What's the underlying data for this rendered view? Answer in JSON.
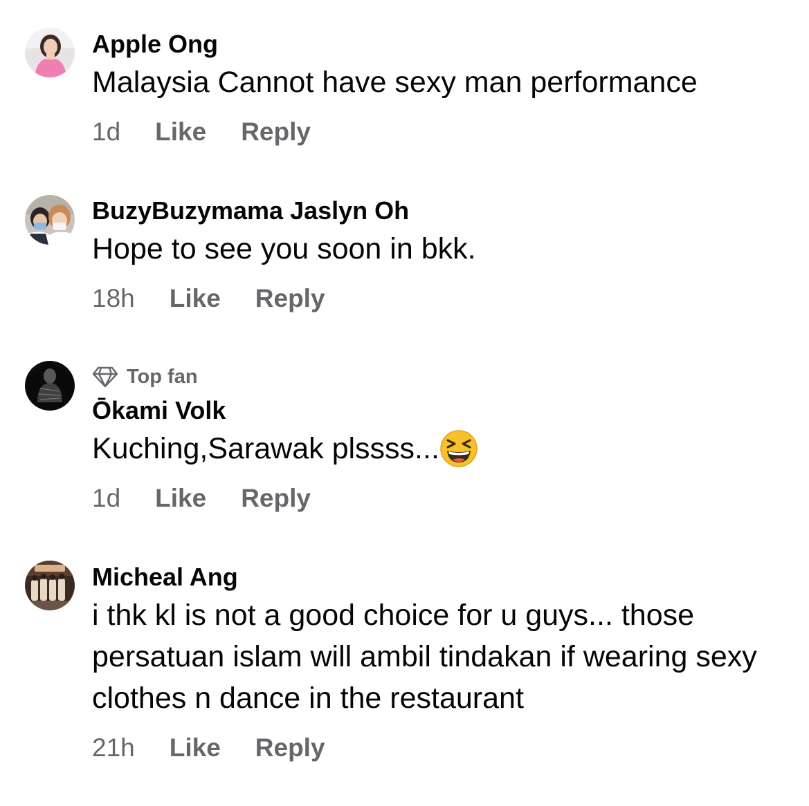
{
  "comments": [
    {
      "author": "Apple Ong",
      "text": "Malaysia Cannot have sexy man performance",
      "time": "1d",
      "like_label": "Like",
      "reply_label": "Reply",
      "avatar_icon": "profile-photo-woman-pink"
    },
    {
      "author": "BuzyBuzymama Jaslyn Oh",
      "text": "Hope to see you soon in bkk.",
      "time": "18h",
      "like_label": "Like",
      "reply_label": "Reply",
      "avatar_icon": "profile-photo-two-people-masks"
    },
    {
      "badge": "Top fan",
      "badge_icon": "diamond-icon",
      "author": "Ōkami Volk",
      "text": "Kuching,Sarawak plssss...",
      "emoji": "grinning-squinting-face-emoji",
      "time": "1d",
      "like_label": "Like",
      "reply_label": "Reply",
      "avatar_icon": "profile-photo-dark-figure"
    },
    {
      "author": "Micheal Ang",
      "text": "i thk kl is not a good choice for u guys... those persatuan islam will ambil tindakan if wearing sexy clothes n dance in the restaurant",
      "time": "21h",
      "like_label": "Like",
      "reply_label": "Reply",
      "avatar_icon": "profile-photo-group"
    }
  ],
  "colors": {
    "text": "#050505",
    "secondary": "#65676b",
    "background": "#ffffff",
    "emoji_face": "#f7c12b"
  }
}
